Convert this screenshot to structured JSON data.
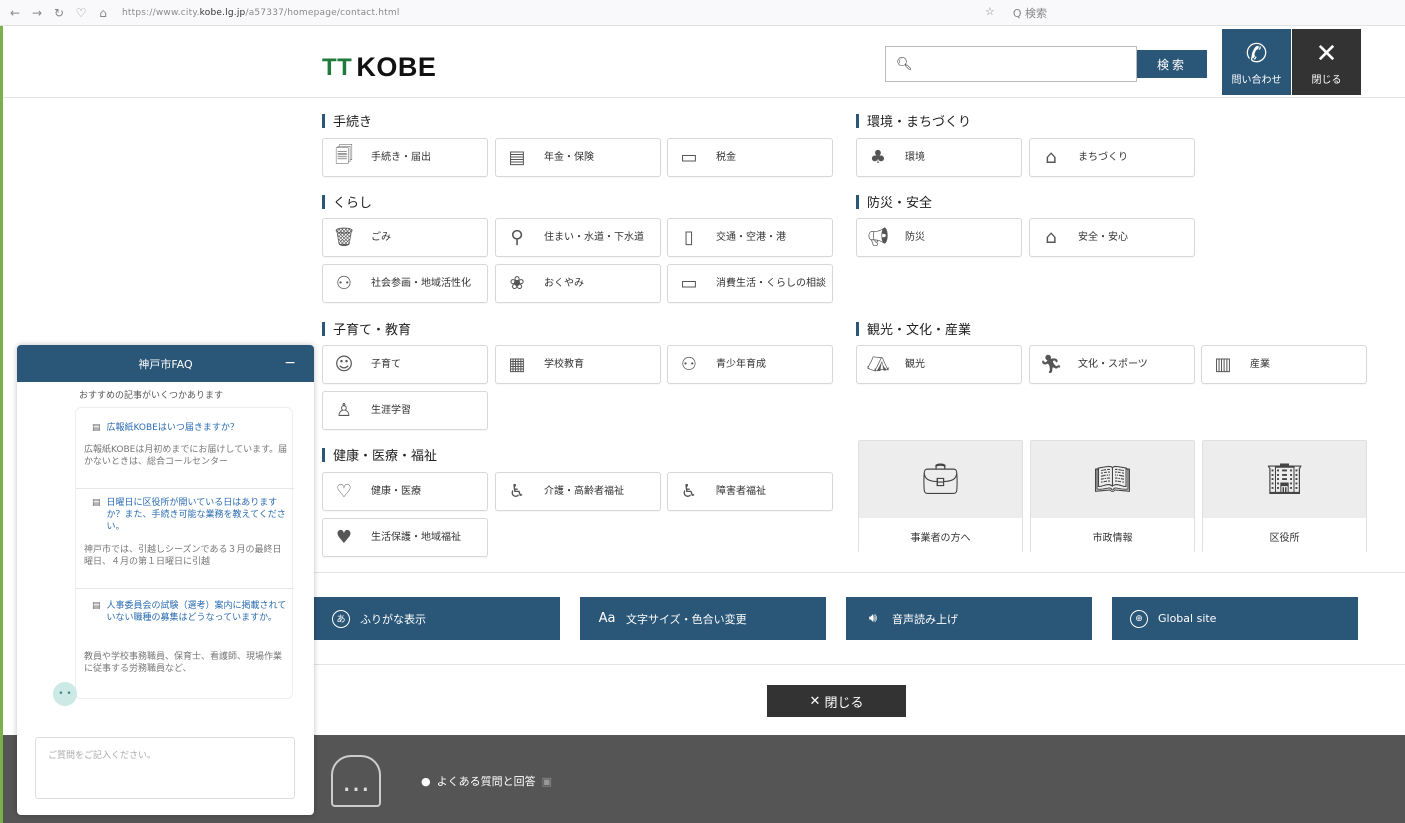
{
  "browser": {
    "url_prefix": "https://www.city.",
    "url_domain": "kobe.lg.jp",
    "url_suffix": "/a57337/homepage/contact.html",
    "search_label": "Q 検索"
  },
  "header": {
    "logo_text": "KOBE",
    "search_button": "検索",
    "contact_label": "問い合わせ",
    "close_label": "閉じる"
  },
  "sections": {
    "procedures": "手続き",
    "environment": "環境・まちづくり",
    "living": "くらし",
    "disaster": "防災・安全",
    "childcare": "子育て・教育",
    "tourism": "観光・文化・産業",
    "health": "健康・医療・福祉"
  },
  "items": {
    "procedures": [
      "手続き・届出",
      "年金・保険",
      "税金"
    ],
    "environment": [
      "環境",
      "まちづくり"
    ],
    "living": [
      "ごみ",
      "住まい・水道・下水道",
      "交通・空港・港",
      "社会参画・地域活性化",
      "おくやみ",
      "消費生活・くらしの相談"
    ],
    "disaster": [
      "防災",
      "安全・安心"
    ],
    "childcare": [
      "子育て",
      "学校教育",
      "青少年育成",
      "生涯学習"
    ],
    "tourism": [
      "観光",
      "文化・スポーツ",
      "産業"
    ],
    "health": [
      "健康・医療",
      "介護・高齢者福祉",
      "障害者福祉",
      "生活保護・地域福祉"
    ]
  },
  "cards": [
    "事業者の方へ",
    "市政情報",
    "区役所"
  ],
  "utilities": [
    "ふりがな表示",
    "文字サイズ・色合い変更",
    "音声読み上げ",
    "Global site"
  ],
  "close_bottom": "閉じる",
  "footer": {
    "faq_link": "よくある質問と回答"
  },
  "chat": {
    "title": "神戸市FAQ",
    "intro": "おすすめの記事がいくつかあります",
    "faqs": [
      {
        "q": "広報紙KOBEはいつ届きますか？",
        "a": "広報紙KOBEは月初めまでにお届けしています。届かないときは、総合コールセンター"
      },
      {
        "q": "日曜日に区役所が開いている日はありますか？また、手続き可能な業務を教えてください。",
        "a": "神戸市では、引越しシーズンである３月の最終日曜日、４月の第１日曜日に引越"
      },
      {
        "q": "人事委員会の試験（選考）案内に掲載されていない職種の募集はどうなっていますか。",
        "a": "教員や学校事務職員、保育士、看護師、現場作業に従事する労務職員など、"
      }
    ],
    "input_placeholder": "ご質問をご記入ください。"
  }
}
